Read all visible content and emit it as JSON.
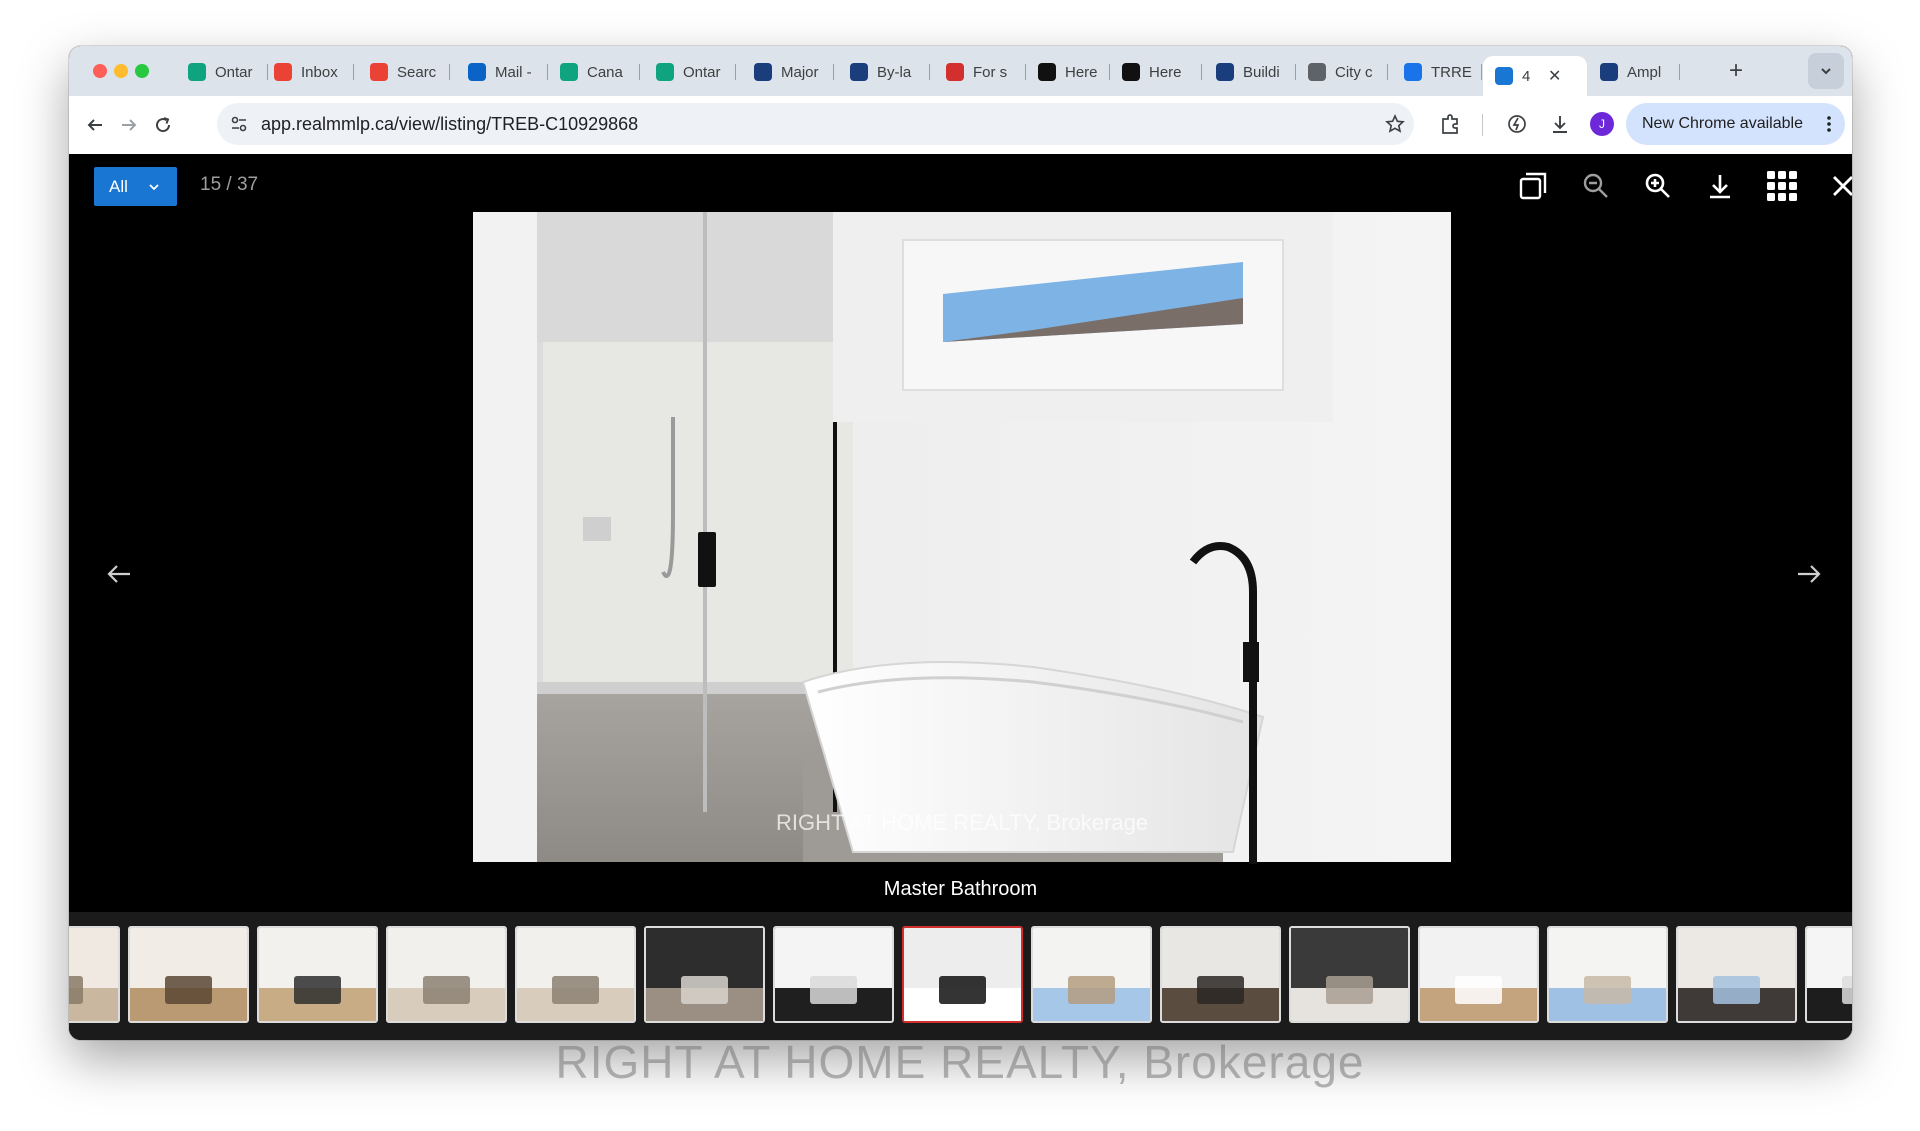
{
  "browser": {
    "tabs": [
      {
        "label": "Ontar",
        "icon": "openai-icon",
        "color": "#10a37f"
      },
      {
        "label": "Inbox",
        "icon": "gmail-icon",
        "color": "#ea4335"
      },
      {
        "label": "Searc",
        "icon": "gmail-icon",
        "color": "#ea4335"
      },
      {
        "label": "Mail -",
        "icon": "outlook-icon",
        "color": "#0a64c8"
      },
      {
        "label": "Cana",
        "icon": "openai-icon",
        "color": "#10a37f"
      },
      {
        "label": "Ontar",
        "icon": "openai-icon",
        "color": "#10a37f"
      },
      {
        "label": "Major",
        "icon": "city-hall-icon",
        "color": "#1a3d7c"
      },
      {
        "label": "By-la",
        "icon": "city-hall-icon",
        "color": "#1a3d7c"
      },
      {
        "label": "For s",
        "icon": "realtor-icon",
        "color": "#d32f2f"
      },
      {
        "label": "Here",
        "icon": "nyt-icon",
        "color": "#111111"
      },
      {
        "label": "Here",
        "icon": "nyt-icon",
        "color": "#111111"
      },
      {
        "label": "Buildi",
        "icon": "city-hall-icon",
        "color": "#1a3d7c"
      },
      {
        "label": "City c",
        "icon": "globe-icon",
        "color": "#5f6368"
      },
      {
        "label": "TRRE",
        "icon": "dots-icon",
        "color": "#1a73e8"
      },
      {
        "label": "4",
        "icon": "realmm-icon",
        "color": "#1976d2",
        "active": true
      },
      {
        "label": "Ampl",
        "icon": "bars-icon",
        "color": "#1a3d7c"
      }
    ],
    "new_tab": "+",
    "url": "app.realmmlp.ca/view/listing/TREB-C10929868",
    "update_label": "New Chrome available",
    "avatar_initial": "J"
  },
  "viewer": {
    "filter_label": "All",
    "counter": "15 / 37",
    "watermark": "RIGHT AT HOME REALTY, Brokerage",
    "caption": "Master Bathroom",
    "thumbnails": [
      {
        "scene": "living"
      },
      {
        "scene": "living-dining"
      },
      {
        "scene": "stairs"
      },
      {
        "scene": "bedroom"
      },
      {
        "scene": "bedroom"
      },
      {
        "scene": "closet"
      },
      {
        "scene": "bath-vanity"
      },
      {
        "scene": "master-bath",
        "selected": true
      },
      {
        "scene": "bedroom-window"
      },
      {
        "scene": "bedroom-dark"
      },
      {
        "scene": "bath-toilet"
      },
      {
        "scene": "hallway"
      },
      {
        "scene": "bedroom-bright"
      },
      {
        "scene": "bedroom-dark2"
      },
      {
        "scene": "bath-mirror"
      }
    ]
  },
  "page_watermark": "RIGHT AT HOME REALTY, Brokerage"
}
